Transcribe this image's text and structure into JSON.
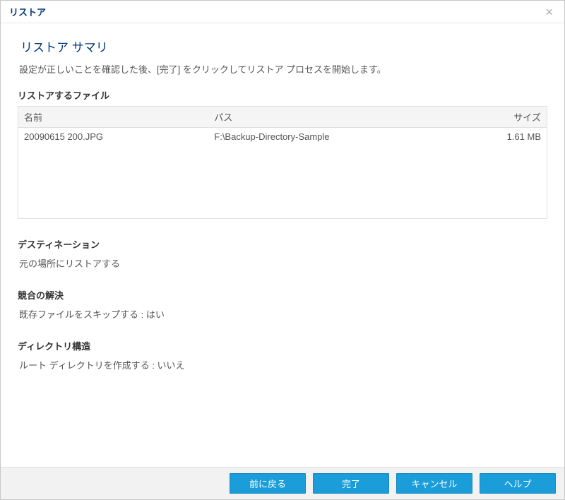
{
  "titlebar": {
    "title": "リストア"
  },
  "main": {
    "heading": "リストア サマリ",
    "instruction": "設定が正しいことを確認した後、[完了] をクリックしてリストア プロセスを開始します。"
  },
  "files": {
    "section_label": "リストアするファイル",
    "columns": {
      "name": "名前",
      "path": "パス",
      "size": "サイズ"
    },
    "rows": [
      {
        "name": "20090615 200.JPG",
        "path": "F:\\Backup-Directory-Sample",
        "size": "1.61 MB"
      }
    ]
  },
  "destination": {
    "label": "デスティネーション",
    "value": "元の場所にリストアする"
  },
  "conflict": {
    "label": "競合の解決",
    "value": "既存ファイルをスキップする : はい"
  },
  "directory": {
    "label": "ディレクトリ構造",
    "value": "ルート ディレクトリを作成する : いいえ"
  },
  "footer": {
    "back": "前に戻る",
    "finish": "完了",
    "cancel": "キャンセル",
    "help": "ヘルプ"
  }
}
